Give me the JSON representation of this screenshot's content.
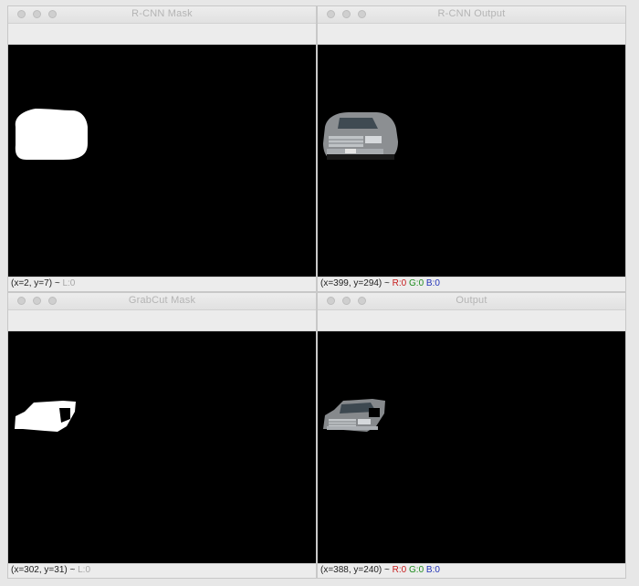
{
  "windows": {
    "rcnn_mask": {
      "title": "R-CNN Mask",
      "status": {
        "coords": "(x=2, y=7)",
        "sep": "~",
        "l": "L:0"
      }
    },
    "rcnn_output": {
      "title": "R-CNN Output",
      "status": {
        "coords": "(x=399, y=294)",
        "sep": "~",
        "r": "R:0",
        "g": "G:0",
        "b": "B:0"
      }
    },
    "grabcut_mask": {
      "title": "GrabCut Mask",
      "status": {
        "coords": "(x=302, y=31)",
        "sep": "~",
        "l": "L:0"
      }
    },
    "output": {
      "title": "Output",
      "status": {
        "coords": "(x=388, y=240)",
        "sep": "~",
        "r": "R:0",
        "g": "G:0",
        "b": "B:0"
      }
    }
  },
  "icons": [
    "close-dot",
    "minimize-dot",
    "zoom-dot"
  ],
  "colors": {
    "background": "#e7e7e7",
    "canvas": "#000000",
    "red": "#c61b1b",
    "green": "#1f8d1f",
    "blue": "#2233b8"
  }
}
